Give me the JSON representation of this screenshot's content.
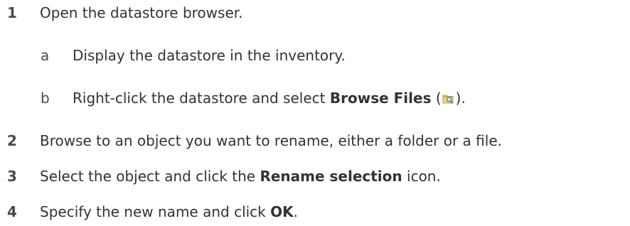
{
  "steps": [
    {
      "number": "1",
      "text": "Open the datastore browser.",
      "substeps": [
        {
          "letter": "a",
          "text": "Display the datastore in the inventory."
        },
        {
          "letter": "b",
          "text_before": "Right-click the datastore and select ",
          "bold": "Browse Files",
          "text_mid": " (",
          "icon": "datastore-browser-icon",
          "text_after": ")."
        }
      ]
    },
    {
      "number": "2",
      "text": "Browse to an object you want to rename, either a folder or a file."
    },
    {
      "number": "3",
      "text_before": "Select the object and click the ",
      "bold": "Rename selection",
      "text_after": " icon."
    },
    {
      "number": "4",
      "text_before": "Specify the new name and click ",
      "bold": "OK",
      "text_after": "."
    }
  ]
}
